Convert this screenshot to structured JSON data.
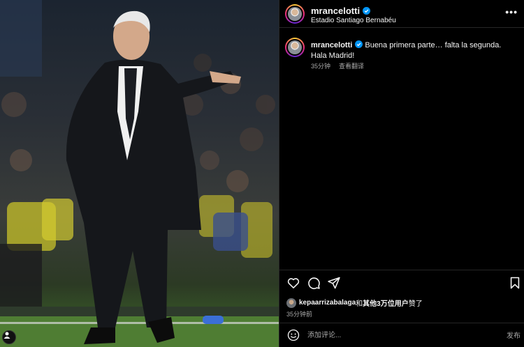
{
  "post": {
    "username": "mrancelotti",
    "location": "Estadio Santiago Bernabéu",
    "caption": "Buena primera parte… falta la segunda. Hala Madrid!",
    "age": "35分钟",
    "translate_label": "查看翻译",
    "likes_user": "kepaarrizabalaga",
    "likes_connector": "和",
    "likes_others": "其他3万位用户",
    "likes_suffix": "赞了",
    "timestamp": "35分钟前",
    "comment_placeholder": "添加评论...",
    "post_button": "发布",
    "more_icon": "more-horizontal-icon",
    "verified_icon": "verified-badge-icon"
  },
  "icons": {
    "like": "heart-icon",
    "comment": "comment-bubble-icon",
    "share": "paper-plane-icon",
    "save": "bookmark-icon",
    "emoji": "smiley-icon"
  },
  "colors": {
    "background": "#000000",
    "text": "#f5f5f5",
    "secondary_text": "#a8a8a8",
    "verified": "#0095f6",
    "divider": "#262626"
  }
}
